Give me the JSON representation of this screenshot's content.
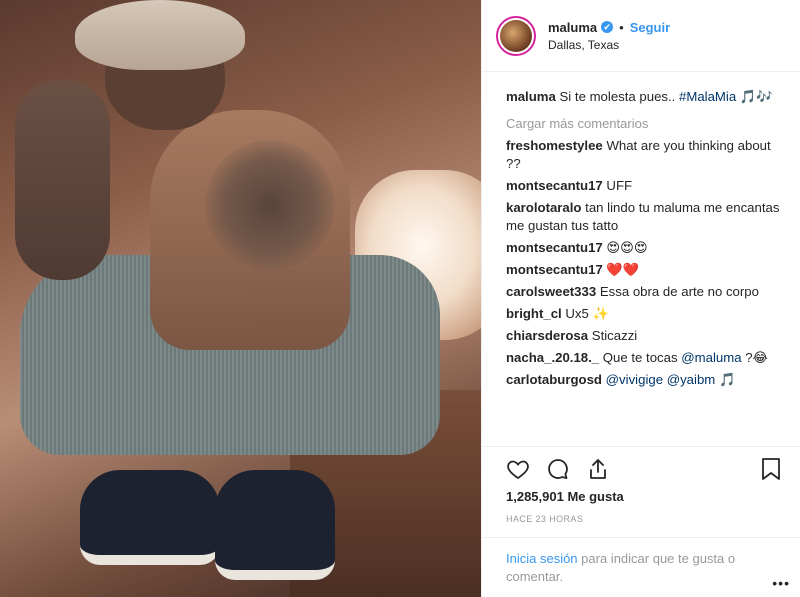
{
  "post": {
    "username": "maluma",
    "verified_icon": "✔",
    "follow_label": "Seguir",
    "location": "Dallas, Texas",
    "caption_user": "maluma",
    "caption_text": "Si te molesta pues..",
    "caption_tag": "#MalaMia",
    "caption_emoji": "🎵🎶",
    "load_more": "Cargar más comentarios"
  },
  "comments": [
    {
      "user": "freshomestylee",
      "text": "What are you thinking about ??"
    },
    {
      "user": "montsecantu17",
      "text": "UFF"
    },
    {
      "user": "karolotaralo",
      "text": "tan lindo tu maluma me encantas me gustan tus tatto"
    },
    {
      "user": "montsecantu17",
      "text": "😍😍😍"
    },
    {
      "user": "montsecantu17",
      "text": "❤️❤️"
    },
    {
      "user": "carolsweet333",
      "text": "Essa obra de arte no corpo"
    },
    {
      "user": "bright_cl",
      "text": "Ux5 ✨"
    },
    {
      "user": "chiarsderosa",
      "text": "Sticazzi"
    },
    {
      "user": "nacha_.20.18._",
      "text": "Que te tocas",
      "mention": "@maluma",
      "suffix": "?😂"
    },
    {
      "user": "carlotaburgosd",
      "text": "",
      "mention": "@vivigige @yaibm",
      "suffix": "🎵"
    }
  ],
  "footer": {
    "likes": "1,285,901 Me gusta",
    "time": "HACE 23 HORAS",
    "login_link": "Inicia sesión",
    "login_text": "para indicar que te gusta o comentar.",
    "more": "•••"
  },
  "icons": [
    "heart-icon",
    "comment-icon",
    "share-icon",
    "bookmark-icon",
    "verified-icon"
  ],
  "colors": {
    "link": "#3897f0",
    "verified": "#3897f0",
    "muted": "#999999",
    "text": "#262626"
  }
}
